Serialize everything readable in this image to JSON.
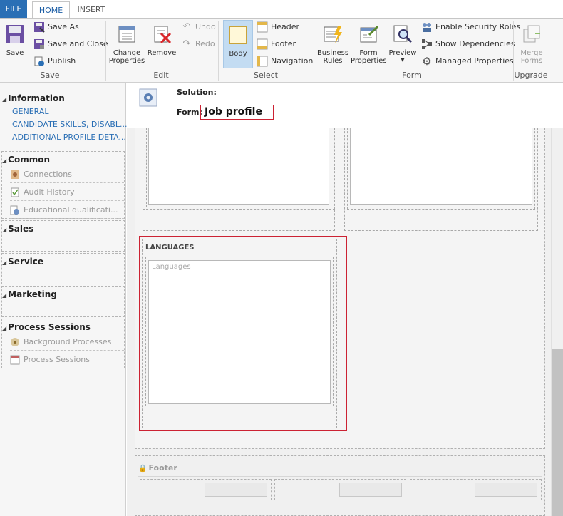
{
  "tabs": {
    "file": "FILE",
    "home": "HOME",
    "insert": "INSERT"
  },
  "ribbon": {
    "save": {
      "save": "Save",
      "save_as": "Save As",
      "save_and_close": "Save and Close",
      "publish": "Publish",
      "group": "Save"
    },
    "edit": {
      "change_properties_line1": "Change",
      "change_properties_line2": "Properties",
      "remove": "Remove",
      "undo": "Undo",
      "redo": "Redo",
      "group": "Edit"
    },
    "select": {
      "body": "Body",
      "header": "Header",
      "footer": "Footer",
      "navigation": "Navigation",
      "group": "Select"
    },
    "form": {
      "business_rules_line1": "Business",
      "business_rules_line2": "Rules",
      "form_properties_line1": "Form",
      "form_properties_line2": "Properties",
      "preview": "Preview",
      "enable_security_roles": "Enable Security Roles",
      "show_dependencies": "Show Dependencies",
      "managed_properties": "Managed Properties",
      "group": "Form"
    },
    "upgrade": {
      "merge_forms_line1": "Merge",
      "merge_forms_line2": "Forms",
      "group": "Upgrade"
    }
  },
  "nav": {
    "information": {
      "title": "Information",
      "links": [
        "GENERAL",
        "CANDIDATE SKILLS, DISABL...",
        "ADDITIONAL PROFILE DETA..."
      ]
    },
    "common": {
      "title": "Common",
      "items": [
        "Connections",
        "Audit History",
        "Educational qualificati..."
      ]
    },
    "sales": {
      "title": "Sales"
    },
    "service": {
      "title": "Service"
    },
    "marketing": {
      "title": "Marketing"
    },
    "process_sessions": {
      "title": "Process Sessions",
      "items": [
        "Background Processes",
        "Process Sessions"
      ]
    }
  },
  "form_header": {
    "solution_label": "Solution:",
    "form_label": "Form:",
    "form_name": "Job profile"
  },
  "canvas": {
    "languages_section_title": "LANGUAGES",
    "languages_placeholder": "Languages",
    "footer_label": "Footer"
  },
  "colors": {
    "accent": "#2a6fb5",
    "selection_border": "#cc2233",
    "body_selected": "#c3dcf2"
  }
}
